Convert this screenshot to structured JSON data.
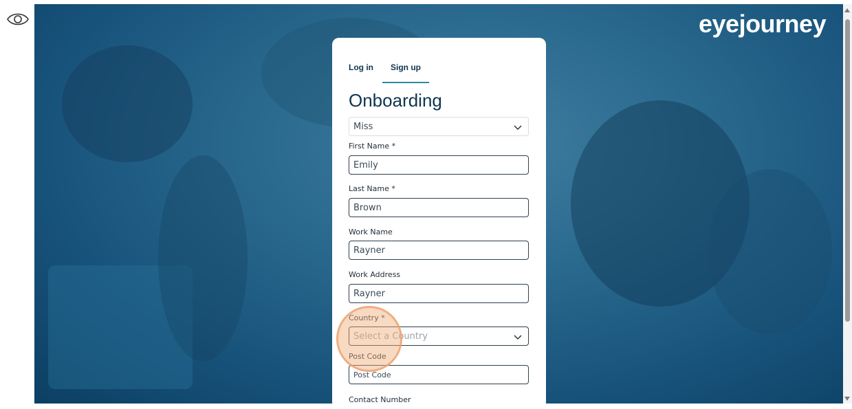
{
  "logo": "eyejourney",
  "tabs": [
    {
      "label": "Log in"
    },
    {
      "label": "Sign up"
    }
  ],
  "title": "Onboarding",
  "form": {
    "salutation": {
      "value": "Miss"
    },
    "first_name": {
      "label": "First Name *",
      "value": "Emily"
    },
    "last_name": {
      "label": "Last Name *",
      "value": "Brown"
    },
    "work_name": {
      "label": "Work Name",
      "value": "Rayner"
    },
    "work_address": {
      "label": "Work Address",
      "value": "Rayner"
    },
    "country": {
      "label": "Country *",
      "placeholder": "Select a Country"
    },
    "post_code": {
      "label": "Post Code",
      "placeholder": "Post Code"
    },
    "contact_number": {
      "label": "Contact Number"
    }
  },
  "colors": {
    "brand_dark": "#0f3550",
    "tab_accent": "#2a8aa0",
    "background_blue": "#2b6a8f",
    "click_highlight": "#f0aa78"
  },
  "icons": {
    "left_rail": "eye-icon",
    "select_chevron": "chevron-down-icon"
  }
}
